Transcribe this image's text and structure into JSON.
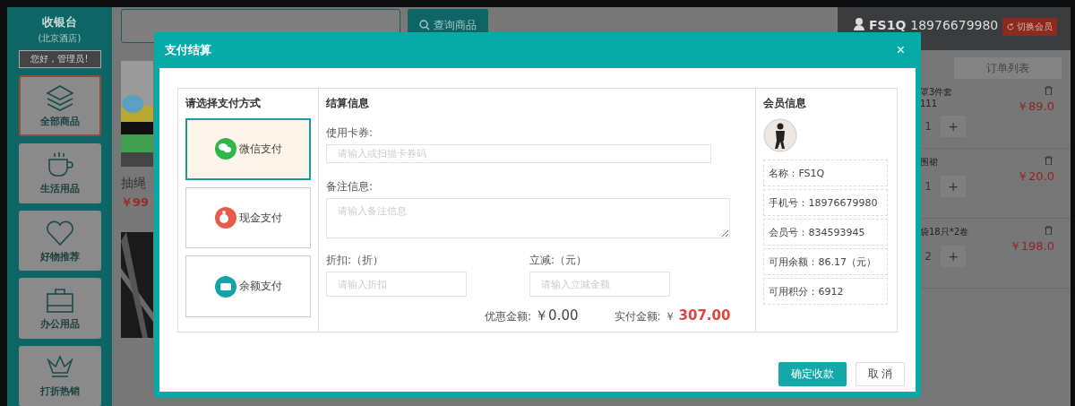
{
  "sidebar": {
    "title": "收银台",
    "subtitle": "(北京酒店)",
    "greeting": "您好，管理员!",
    "categories": [
      {
        "label": "全部商品",
        "selected": true
      },
      {
        "label": "生活用品",
        "selected": false
      },
      {
        "label": "好物推荐",
        "selected": false
      },
      {
        "label": "办公用品",
        "selected": false
      },
      {
        "label": "打折热销",
        "selected": false
      }
    ]
  },
  "main": {
    "search_button": "查询商品",
    "products": [
      {
        "name": "抽绳",
        "price": "￥99"
      }
    ]
  },
  "cart": {
    "member_name": "FS1Q",
    "member_phone": "18976679980",
    "switch_button": "切换会员",
    "tab": "订单列表",
    "items": [
      {
        "name": "罩3件套",
        "note": "111",
        "price": "￥89.0",
        "qty": "1",
        "plus": "+"
      },
      {
        "name": "围裙",
        "price": "￥20.0",
        "qty": "1",
        "plus": "+"
      },
      {
        "name": "袋18只*2卷",
        "price": "￥198.0",
        "qty": "2",
        "plus": "+"
      }
    ]
  },
  "dialog": {
    "title": "支付结算",
    "close": "×",
    "payment": {
      "title": "请选择支付方式",
      "methods": [
        {
          "kind": "wechat",
          "label": "微信支付",
          "color": "#2eb84a",
          "selected": true
        },
        {
          "kind": "cash",
          "label": "现金支付",
          "color": "#ea5a4b",
          "selected": false
        },
        {
          "kind": "balance",
          "label": "余额支付",
          "color": "#14a3a8",
          "selected": false
        }
      ]
    },
    "settlement": {
      "title": "结算信息",
      "coupon_label": "使用卡券:",
      "coupon_placeholder": "请输入或扫描卡券码",
      "remark_label": "备注信息:",
      "remark_placeholder": "请输入备注信息",
      "discount_label": "折扣:（折）",
      "discount_placeholder": "请输入折扣",
      "reduce_label": "立减:（元）",
      "reduce_placeholder": "请输入立减金额",
      "saving_label": "优惠金额:",
      "saving_value": "￥0.00",
      "pay_label": "实付金额:",
      "pay_currency": "￥",
      "pay_value": "307.00"
    },
    "member": {
      "title": "会员信息",
      "fields": [
        "名称：FS1Q",
        "手机号：18976679980",
        "会员号：834593945",
        "可用余额：86.17（元）",
        "可用积分：6912"
      ]
    },
    "confirm_button": "确定收款",
    "cancel_button": "取 消"
  }
}
